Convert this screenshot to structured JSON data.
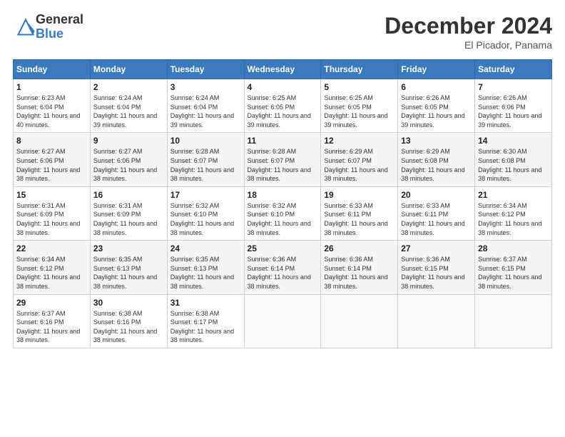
{
  "logo": {
    "general": "General",
    "blue": "Blue"
  },
  "title": "December 2024",
  "subtitle": "El Picador, Panama",
  "headers": [
    "Sunday",
    "Monday",
    "Tuesday",
    "Wednesday",
    "Thursday",
    "Friday",
    "Saturday"
  ],
  "weeks": [
    [
      {
        "day": "1",
        "sunrise": "Sunrise: 6:23 AM",
        "sunset": "Sunset: 6:04 PM",
        "daylight": "Daylight: 11 hours and 40 minutes."
      },
      {
        "day": "2",
        "sunrise": "Sunrise: 6:24 AM",
        "sunset": "Sunset: 6:04 PM",
        "daylight": "Daylight: 11 hours and 39 minutes."
      },
      {
        "day": "3",
        "sunrise": "Sunrise: 6:24 AM",
        "sunset": "Sunset: 6:04 PM",
        "daylight": "Daylight: 11 hours and 39 minutes."
      },
      {
        "day": "4",
        "sunrise": "Sunrise: 6:25 AM",
        "sunset": "Sunset: 6:05 PM",
        "daylight": "Daylight: 11 hours and 39 minutes."
      },
      {
        "day": "5",
        "sunrise": "Sunrise: 6:25 AM",
        "sunset": "Sunset: 6:05 PM",
        "daylight": "Daylight: 11 hours and 39 minutes."
      },
      {
        "day": "6",
        "sunrise": "Sunrise: 6:26 AM",
        "sunset": "Sunset: 6:05 PM",
        "daylight": "Daylight: 11 hours and 39 minutes."
      },
      {
        "day": "7",
        "sunrise": "Sunrise: 6:26 AM",
        "sunset": "Sunset: 6:06 PM",
        "daylight": "Daylight: 11 hours and 39 minutes."
      }
    ],
    [
      {
        "day": "8",
        "sunrise": "Sunrise: 6:27 AM",
        "sunset": "Sunset: 6:06 PM",
        "daylight": "Daylight: 11 hours and 38 minutes."
      },
      {
        "day": "9",
        "sunrise": "Sunrise: 6:27 AM",
        "sunset": "Sunset: 6:06 PM",
        "daylight": "Daylight: 11 hours and 38 minutes."
      },
      {
        "day": "10",
        "sunrise": "Sunrise: 6:28 AM",
        "sunset": "Sunset: 6:07 PM",
        "daylight": "Daylight: 11 hours and 38 minutes."
      },
      {
        "day": "11",
        "sunrise": "Sunrise: 6:28 AM",
        "sunset": "Sunset: 6:07 PM",
        "daylight": "Daylight: 11 hours and 38 minutes."
      },
      {
        "day": "12",
        "sunrise": "Sunrise: 6:29 AM",
        "sunset": "Sunset: 6:07 PM",
        "daylight": "Daylight: 11 hours and 38 minutes."
      },
      {
        "day": "13",
        "sunrise": "Sunrise: 6:29 AM",
        "sunset": "Sunset: 6:08 PM",
        "daylight": "Daylight: 11 hours and 38 minutes."
      },
      {
        "day": "14",
        "sunrise": "Sunrise: 6:30 AM",
        "sunset": "Sunset: 6:08 PM",
        "daylight": "Daylight: 11 hours and 38 minutes."
      }
    ],
    [
      {
        "day": "15",
        "sunrise": "Sunrise: 6:31 AM",
        "sunset": "Sunset: 6:09 PM",
        "daylight": "Daylight: 11 hours and 38 minutes."
      },
      {
        "day": "16",
        "sunrise": "Sunrise: 6:31 AM",
        "sunset": "Sunset: 6:09 PM",
        "daylight": "Daylight: 11 hours and 38 minutes."
      },
      {
        "day": "17",
        "sunrise": "Sunrise: 6:32 AM",
        "sunset": "Sunset: 6:10 PM",
        "daylight": "Daylight: 11 hours and 38 minutes."
      },
      {
        "day": "18",
        "sunrise": "Sunrise: 6:32 AM",
        "sunset": "Sunset: 6:10 PM",
        "daylight": "Daylight: 11 hours and 38 minutes."
      },
      {
        "day": "19",
        "sunrise": "Sunrise: 6:33 AM",
        "sunset": "Sunset: 6:11 PM",
        "daylight": "Daylight: 11 hours and 38 minutes."
      },
      {
        "day": "20",
        "sunrise": "Sunrise: 6:33 AM",
        "sunset": "Sunset: 6:11 PM",
        "daylight": "Daylight: 11 hours and 38 minutes."
      },
      {
        "day": "21",
        "sunrise": "Sunrise: 6:34 AM",
        "sunset": "Sunset: 6:12 PM",
        "daylight": "Daylight: 11 hours and 38 minutes."
      }
    ],
    [
      {
        "day": "22",
        "sunrise": "Sunrise: 6:34 AM",
        "sunset": "Sunset: 6:12 PM",
        "daylight": "Daylight: 11 hours and 38 minutes."
      },
      {
        "day": "23",
        "sunrise": "Sunrise: 6:35 AM",
        "sunset": "Sunset: 6:13 PM",
        "daylight": "Daylight: 11 hours and 38 minutes."
      },
      {
        "day": "24",
        "sunrise": "Sunrise: 6:35 AM",
        "sunset": "Sunset: 6:13 PM",
        "daylight": "Daylight: 11 hours and 38 minutes."
      },
      {
        "day": "25",
        "sunrise": "Sunrise: 6:36 AM",
        "sunset": "Sunset: 6:14 PM",
        "daylight": "Daylight: 11 hours and 38 minutes."
      },
      {
        "day": "26",
        "sunrise": "Sunrise: 6:36 AM",
        "sunset": "Sunset: 6:14 PM",
        "daylight": "Daylight: 11 hours and 38 minutes."
      },
      {
        "day": "27",
        "sunrise": "Sunrise: 6:36 AM",
        "sunset": "Sunset: 6:15 PM",
        "daylight": "Daylight: 11 hours and 38 minutes."
      },
      {
        "day": "28",
        "sunrise": "Sunrise: 6:37 AM",
        "sunset": "Sunset: 6:15 PM",
        "daylight": "Daylight: 11 hours and 38 minutes."
      }
    ],
    [
      {
        "day": "29",
        "sunrise": "Sunrise: 6:37 AM",
        "sunset": "Sunset: 6:16 PM",
        "daylight": "Daylight: 11 hours and 38 minutes."
      },
      {
        "day": "30",
        "sunrise": "Sunrise: 6:38 AM",
        "sunset": "Sunset: 6:16 PM",
        "daylight": "Daylight: 11 hours and 38 minutes."
      },
      {
        "day": "31",
        "sunrise": "Sunrise: 6:38 AM",
        "sunset": "Sunset: 6:17 PM",
        "daylight": "Daylight: 11 hours and 38 minutes."
      },
      null,
      null,
      null,
      null
    ]
  ]
}
